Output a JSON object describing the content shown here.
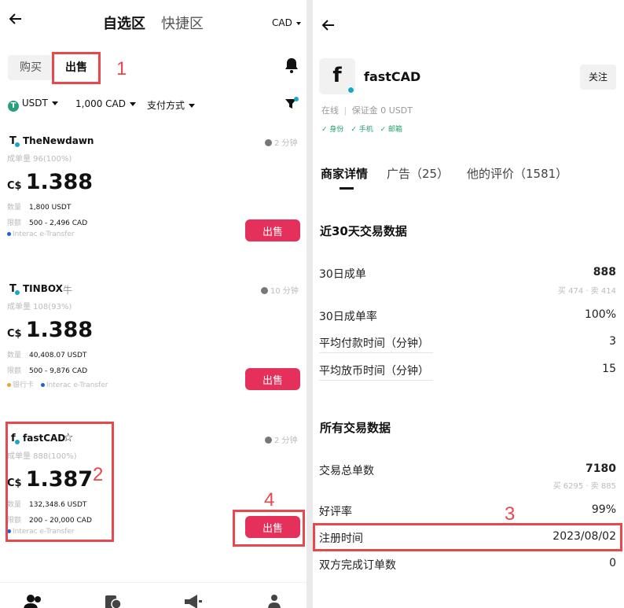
{
  "left": {
    "tabs": [
      "自选区",
      "快捷区"
    ],
    "currency": "CAD",
    "buy_label": "购买",
    "sell_label": "出售",
    "filters": {
      "coin": "USDT",
      "amount": "1,000 CAD",
      "payment": "支付方式"
    },
    "sell_button": "出售",
    "merchants": [
      {
        "initial": "T",
        "name": "TheNewdawn",
        "badge": "",
        "time": "2 分钟",
        "stats": "成单量 96(100%)",
        "price_prefix": "C$",
        "price": "1.388",
        "qty_label": "数量",
        "qty": "1,800 USDT",
        "limit_label": "限额",
        "limit": "500 - 2,496 CAD",
        "payments": [
          "Interac e-Transfer"
        ]
      },
      {
        "initial": "T",
        "name": "TINBOX",
        "badge": "牛",
        "time": "10 分钟",
        "stats": "成单量 108(93%)",
        "price_prefix": "C$",
        "price": "1.388",
        "qty_label": "数量",
        "qty": "40,408.07 USDT",
        "limit_label": "限额",
        "limit": "500 - 9,876 CAD",
        "payments": [
          "银行卡",
          "Interac e-Transfer"
        ]
      },
      {
        "initial": "f",
        "name": "fastCAD",
        "badge": "☆",
        "time": "2 分钟",
        "stats": "成单量 888(100%)",
        "price_prefix": "C$",
        "price": "1.387",
        "qty_label": "数量",
        "qty": "132,348.6 USDT",
        "limit_label": "限额",
        "limit": "200 - 20,000 CAD",
        "payments": [
          "Interac e-Transfer"
        ]
      }
    ],
    "annotations": [
      "1",
      "2",
      "4"
    ]
  },
  "right": {
    "avatar_initial": "f",
    "merchant_name": "fastCAD",
    "follow_label": "关注",
    "status": "在线",
    "deposit": "保证金 0 USDT",
    "verifications": [
      "身份",
      "手机",
      "邮箱"
    ],
    "tabs": [
      "商家详情",
      "广告（25）",
      "他的评价（1581）"
    ],
    "section1_title": "近30天交易数据",
    "orders30_label": "30日成单",
    "orders30_value": "888",
    "orders30_split": "买 474 · 卖 414",
    "rate30_label": "30日成单率",
    "rate30_value": "100%",
    "pay_time_label": "平均付款时间（分钟）",
    "pay_time_value": "3",
    "release_time_label": "平均放币时间（分钟）",
    "release_time_value": "15",
    "section2_title": "所有交易数据",
    "total_label": "交易总单数",
    "total_value": "7180",
    "total_split": "买 6295 · 卖 885",
    "good_label": "好评率",
    "good_value": "99%",
    "reg_label": "注册时间",
    "reg_value": "2023/08/02",
    "mutual_label": "双方完成订单数",
    "mutual_value": "0",
    "annotation": "3"
  },
  "colors": {
    "accent": "#e5305b",
    "annotation": "#e8474c",
    "verify": "#22a06b",
    "online_dot": "#1aa6c8"
  }
}
